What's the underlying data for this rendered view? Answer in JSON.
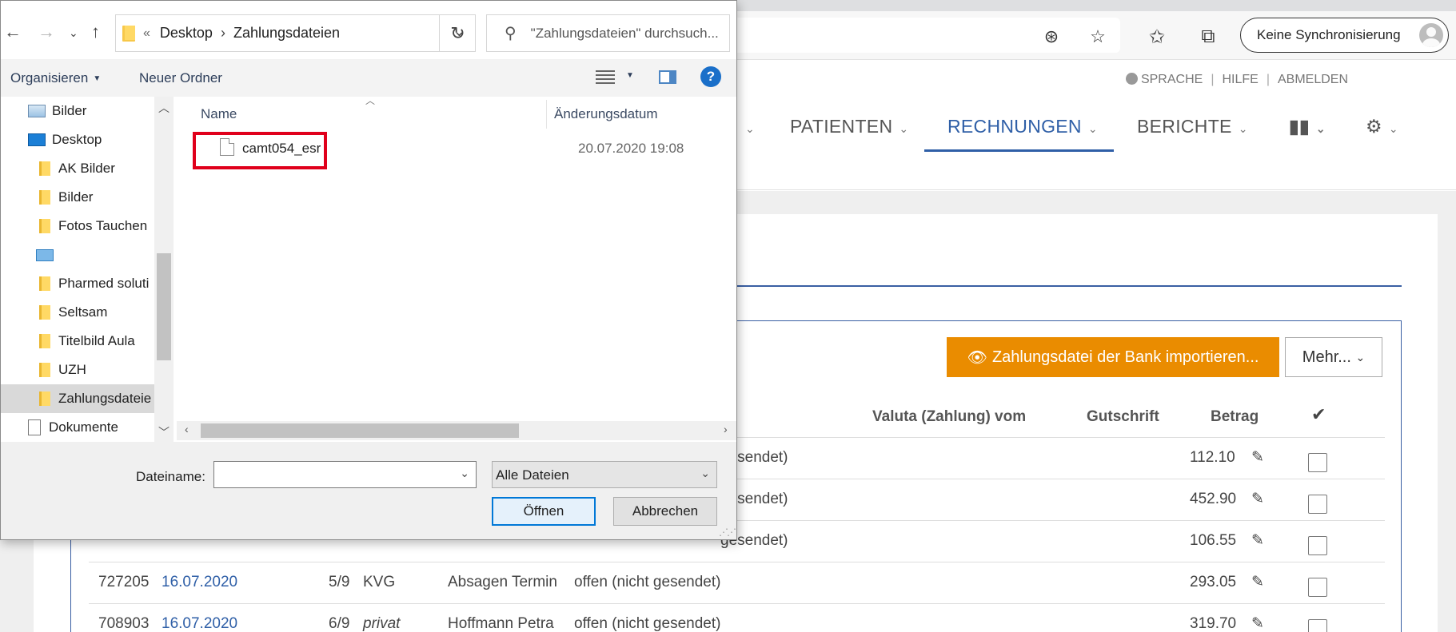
{
  "browser": {
    "sync_label": "Keine Synchronisierung"
  },
  "webpage": {
    "top_links": [
      "SPRACHE",
      "HILFE",
      "ABMELDEN"
    ],
    "nav": {
      "patienten": "PATIENTEN",
      "rechnungen": "RECHNUNGEN",
      "berichte": "BERICHTE"
    },
    "import_button": "Zahlungsdatei der Bank importieren...",
    "more_button": "Mehr...",
    "columns": {
      "valuta": "Valuta (Zahlung) vom",
      "gutschrift": "Gutschrift",
      "betrag": "Betrag"
    },
    "rows": [
      {
        "id": "",
        "date": "",
        "n": "",
        "law": "",
        "name": "",
        "status": "gesendet)",
        "amount": "112.10"
      },
      {
        "id": "",
        "date": "",
        "n": "",
        "law": "",
        "name": "",
        "status": "gesendet)",
        "amount": "452.90"
      },
      {
        "id": "",
        "date": "",
        "n": "",
        "law": "",
        "name": "",
        "status": "gesendet)",
        "amount": "106.55"
      },
      {
        "id": "727205",
        "date": "16.07.2020",
        "n": "5/9",
        "law": "KVG",
        "name": "Absagen Termin",
        "status": "offen (nicht gesendet)",
        "amount": "293.05"
      },
      {
        "id": "708903",
        "date": "16.07.2020",
        "n": "6/9",
        "law": "privat",
        "name": "Hoffmann Petra",
        "status": "offen (nicht gesendet)",
        "amount": "319.70"
      }
    ],
    "colors": {
      "accent": "#2f5fa7",
      "import_button": "#ea8c00"
    }
  },
  "dialog": {
    "path_prefix": "«",
    "path": [
      "Desktop",
      "Zahlungsdateien"
    ],
    "search_placeholder": "\"Zahlungsdateien\" durchsuch...",
    "organize": "Organisieren",
    "new_folder": "Neuer Ordner",
    "nav_items": [
      "Bilder",
      "Desktop",
      "AK Bilder",
      "Bilder",
      "Fotos Tauchen",
      "",
      "Pharmed soluti",
      "Seltsam",
      "Titelbild Aula",
      "UZH",
      "Zahlungsdateie",
      "Dokumente"
    ],
    "col_name": "Name",
    "col_date": "Änderungsdatum",
    "file": {
      "name": "camt054_esr",
      "date": "20.07.2020 19:08"
    },
    "filename_label": "Dateiname:",
    "filename_value": "",
    "filetype": "Alle Dateien",
    "open_button": "Öffnen",
    "cancel_button": "Abbrechen"
  }
}
